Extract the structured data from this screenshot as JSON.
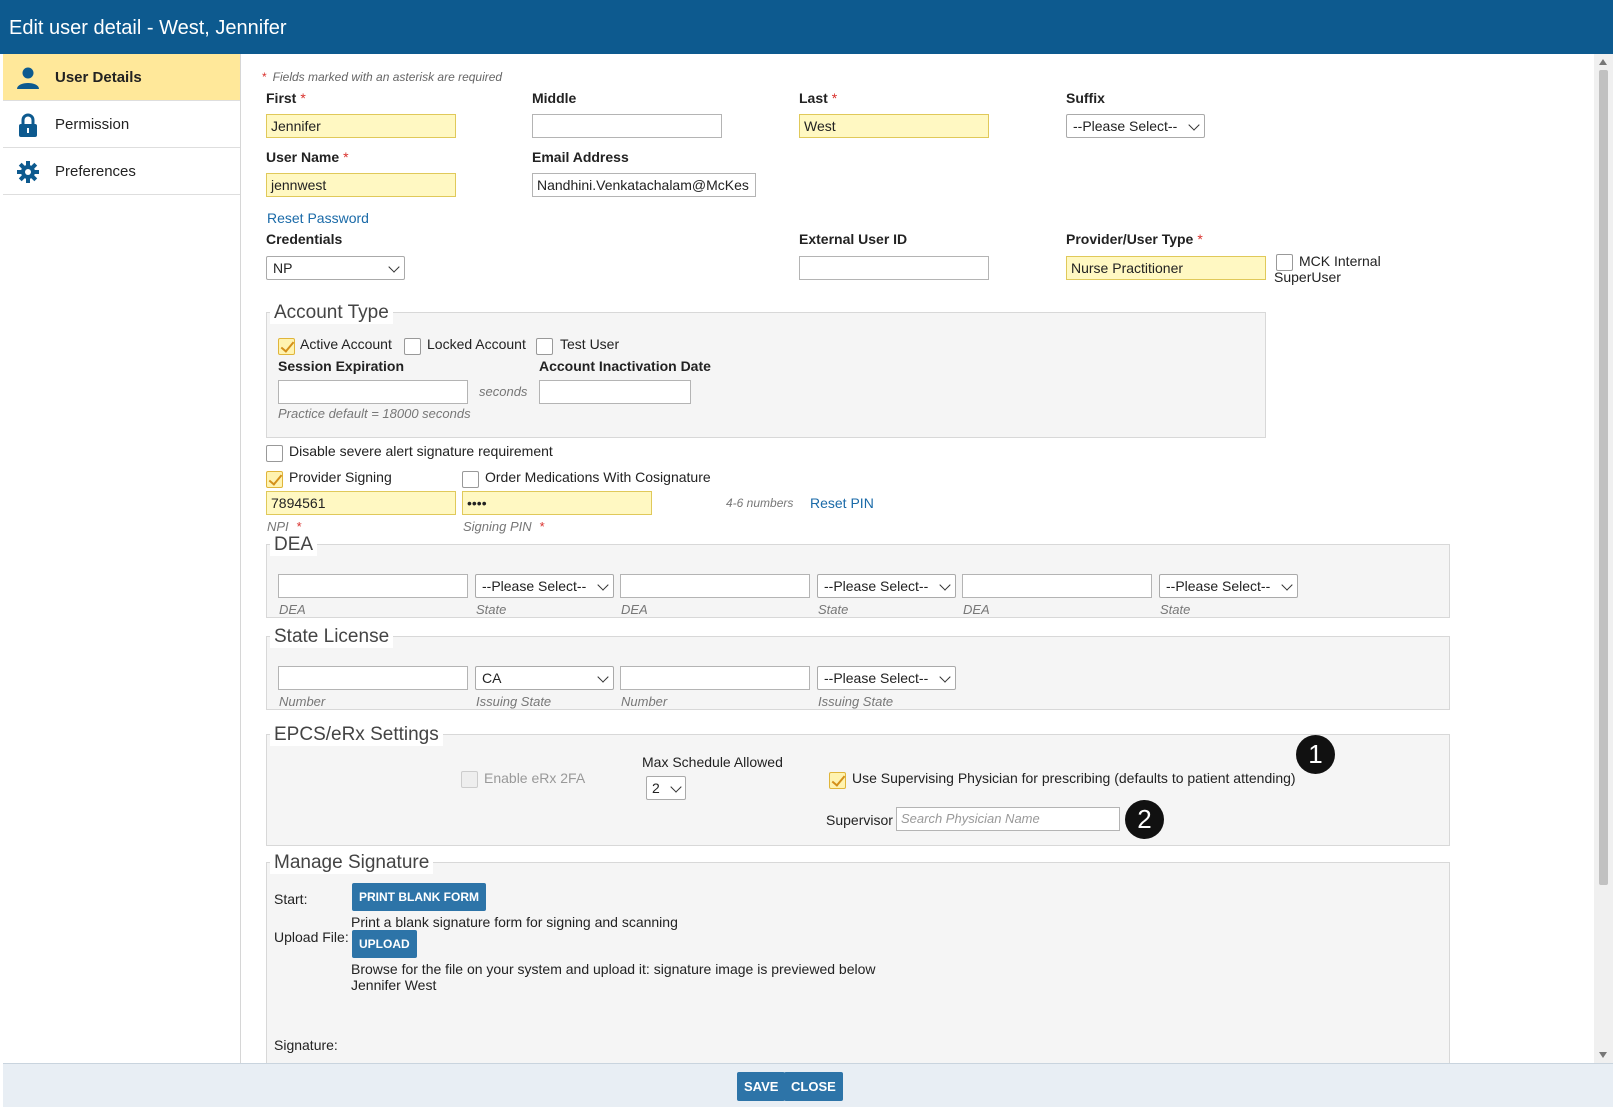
{
  "window": {
    "title": "Edit user detail - West, Jennifer"
  },
  "sidebar": {
    "items": [
      {
        "label": "User Details",
        "icon": "user-icon"
      },
      {
        "label": "Permission",
        "icon": "lock-icon"
      },
      {
        "label": "Preferences",
        "icon": "gear-icon"
      }
    ]
  },
  "form": {
    "required_note": "Fields marked with an asterisk are required",
    "first": {
      "label": "First",
      "value": "Jennifer"
    },
    "middle": {
      "label": "Middle",
      "value": ""
    },
    "last": {
      "label": "Last",
      "value": "West"
    },
    "suffix": {
      "label": "Suffix",
      "value": "--Please Select--"
    },
    "username": {
      "label": "User Name",
      "value": "jennwest"
    },
    "email": {
      "label": "Email Address",
      "value": "Nandhini.Venkatachalam@McKes"
    },
    "reset_password": "Reset Password",
    "credentials": {
      "label": "Credentials",
      "value": "NP"
    },
    "external_id": {
      "label": "External User ID",
      "value": ""
    },
    "provider_type": {
      "label": "Provider/User Type",
      "value": "Nurse Practitioner"
    },
    "mck_internal": {
      "line1": "MCK Internal",
      "line2": "SuperUser"
    }
  },
  "account_type": {
    "title": "Account Type",
    "active": "Active Account",
    "locked": "Locked Account",
    "test": "Test User",
    "session_label": "Session Expiration",
    "session_value": "",
    "seconds": "seconds",
    "inactivation_label": "Account Inactivation Date",
    "inactivation_value": "",
    "practice_default": "Practice default = 18000 seconds"
  },
  "signing": {
    "disable_alert": "Disable severe alert signature requirement",
    "provider_signing": "Provider Signing",
    "order_meds": "Order Medications With Cosignature",
    "npi_value": "7894561",
    "pin_value": "••••",
    "pin_hint": "4-6 numbers",
    "reset_pin": "Reset PIN",
    "npi_label": "NPI",
    "pin_label": "Signing PIN"
  },
  "dea": {
    "title": "DEA",
    "select_placeholder": "--Please Select--",
    "dea_label": "DEA",
    "state_label": "State"
  },
  "state_license": {
    "title": "State License",
    "state1": "CA",
    "state2": "--Please Select--",
    "number_label": "Number",
    "issuing_label": "Issuing State"
  },
  "epcs": {
    "title": "EPCS/eRx Settings",
    "enable_2fa": "Enable eRx 2FA",
    "max_schedule_label": "Max Schedule Allowed",
    "max_schedule_value": "2",
    "use_supervising": "Use Supervising Physician for prescribing (defaults to patient attending)",
    "supervisor_label": "Supervisor",
    "supervisor_placeholder": "Search Physician Name",
    "badge1": "1",
    "badge2": "2"
  },
  "signature": {
    "title": "Manage Signature",
    "start_label": "Start:",
    "print_button": "PRINT BLANK FORM",
    "print_desc": "Print a blank signature form for signing and scanning",
    "upload_label": "Upload File:",
    "upload_button": "UPLOAD",
    "upload_desc": "Browse for the file on your system and upload it: signature image is previewed below",
    "name": "Jennifer West",
    "signature_label": "Signature:"
  },
  "footer": {
    "save": "SAVE",
    "close": "CLOSE"
  },
  "colors": {
    "titlebar": "#0d5a8f",
    "active_tab": "#ffe89a",
    "required_field": "#fff8c2",
    "button": "#2d74a8"
  }
}
